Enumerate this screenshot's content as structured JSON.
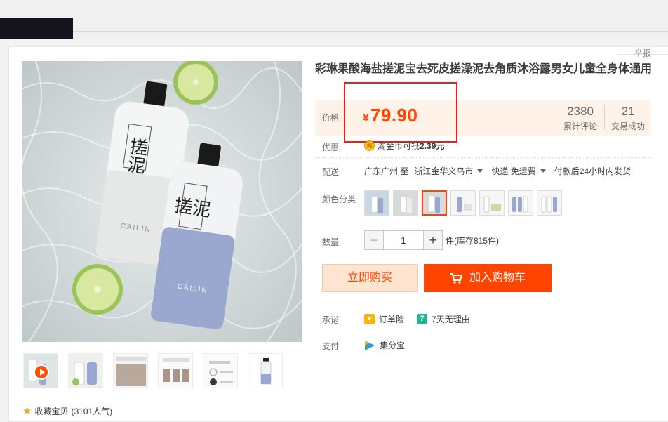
{
  "report": "举报",
  "product": {
    "title": "彩琳果酸海盐搓泥宝去死皮搓澡泥去角质沐浴露男女儿童全身体通用"
  },
  "price": {
    "label": "价格",
    "currency": "¥",
    "value": "79.90",
    "stats": [
      {
        "num": "2380",
        "text": "累计评论"
      },
      {
        "num": "21",
        "text": "交易成功"
      }
    ]
  },
  "coupon": {
    "label": "优惠",
    "icon_text": "淘",
    "text_prefix": "淘金币可抵",
    "amount": "2.39元"
  },
  "shipping": {
    "label": "配送",
    "from": "广东广州 至",
    "to": "浙江金华义乌市",
    "method": "快递 免运费",
    "time": "付款后24小时内发货"
  },
  "sku": {
    "label": "颜色分类",
    "count": 7,
    "selected_index": 2
  },
  "quantity": {
    "label": "数量",
    "minus": "−",
    "value": "1",
    "plus": "+",
    "stock": "件(库存815件)"
  },
  "buttons": {
    "buy_now": "立即购买",
    "add_cart": "加入购物车"
  },
  "promise": {
    "label": "承诺",
    "items": [
      "订单险",
      "7天无理由"
    ],
    "seven_icon": "7"
  },
  "payment": {
    "label": "支付",
    "method": "集分宝"
  },
  "favorite": {
    "text": "收藏宝贝",
    "count": "(3101人气)"
  },
  "product_image": {
    "bottle_text": "搓泥",
    "bottle_brand": "CAILIN"
  },
  "colors": {
    "accent": "#ff4400",
    "price_bg": "#fff2e8",
    "highlight_box": "#e1251b"
  }
}
